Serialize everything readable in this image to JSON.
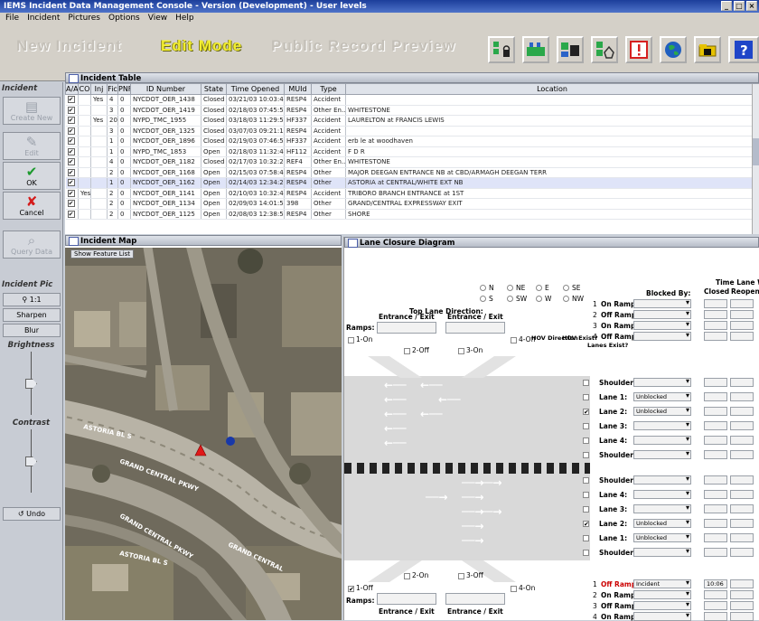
{
  "window": {
    "title": "IEMS Incident Data Management Console - Version (Development) - User levels"
  },
  "menu": [
    "File",
    "Incident",
    "Pictures",
    "Options",
    "View",
    "Help"
  ],
  "modes": {
    "new": "New Incident",
    "edit": "Edit Mode",
    "public": "Public Record Preview"
  },
  "left_panel": {
    "incident_header": "Incident",
    "buttons": [
      {
        "label": "Create New",
        "icon": "📄",
        "enabled": false
      },
      {
        "label": "Edit",
        "icon": "🖉",
        "enabled": false
      },
      {
        "label": "OK",
        "icon": "✔",
        "enabled": true
      },
      {
        "label": "Cancel",
        "icon": "✘",
        "enabled": true
      },
      {
        "label": "Query Data",
        "icon": "🔍",
        "enabled": false
      }
    ],
    "pic_header": "Incident Pic",
    "pic_buttons": [
      "1:1",
      "Sharpen",
      "Blur"
    ],
    "brightness": "Brightness",
    "contrast": "Contrast",
    "undo": "Undo"
  },
  "incident_table": {
    "title": "Incident Table",
    "columns": [
      "A/A",
      "CO",
      "Inj",
      "Fic",
      "PNF",
      "ID Number",
      "State",
      "Time Opened",
      "MUId",
      "Type",
      "Location"
    ],
    "rows": [
      [
        "✔",
        "",
        "Yes",
        "4",
        "0",
        "NYCDOT_OER_1438",
        "Closed",
        "03/21/03 10:03:40",
        "RESP4",
        "Accident",
        ""
      ],
      [
        "✔",
        "",
        "",
        "3",
        "0",
        "NYCDOT_OER_1419",
        "Closed",
        "02/18/03 07:45:50",
        "RESP4",
        "Other En...",
        "WHITESTONE"
      ],
      [
        "✔",
        "",
        "Yes",
        "20",
        "0",
        "NYPD_TMC_1955",
        "Closed",
        "03/18/03 11:29:56",
        "HF337",
        "Accident",
        "LAURELTON at FRANCIS LEWIS"
      ],
      [
        "✔",
        "",
        "",
        "3",
        "0",
        "NYCDOT_OER_1325",
        "Closed",
        "03/07/03 09:21:11",
        "RESP4",
        "Accident",
        ""
      ],
      [
        "✔",
        "",
        "",
        "1",
        "0",
        "NYCDOT_OER_1896",
        "Closed",
        "02/19/03 07:46:53",
        "HF337",
        "Accident",
        "erb le at woodhaven"
      ],
      [
        "✔",
        "",
        "",
        "1",
        "0",
        "NYPD_TMC_1853",
        "Open",
        "02/18/03 11:32:43",
        "HF112",
        "Accident",
        "F D R"
      ],
      [
        "✔",
        "",
        "",
        "4",
        "0",
        "NYCDOT_OER_1182",
        "Closed",
        "02/17/03 10:32:20",
        "REF4",
        "Other En...",
        "WHITESTONE"
      ],
      [
        "✔",
        "",
        "",
        "2",
        "0",
        "NYCDOT_OER_1168",
        "Open",
        "02/15/03 07:58:41",
        "RESP4",
        "Other",
        "MAJOR DEEGAN ENTRANCE NB at CBD/ARMAGH DEEGAN TERR"
      ],
      [
        "✔",
        "",
        "",
        "1",
        "0",
        "NYCDOT_OER_1162",
        "Open",
        "02/14/03 12:34:29",
        "RESP4",
        "Other",
        "ASTORIA at CENTRAL/WHITE EXT NB"
      ],
      [
        "✔",
        "Yes",
        "",
        "2",
        "0",
        "NYCDOT_OER_1141",
        "Open",
        "02/10/03 10:32:48",
        "RESP4",
        "Accident",
        "TRIBORO BRANCH ENTRANCE at 1ST"
      ],
      [
        "✔",
        "",
        "",
        "2",
        "0",
        "NYCDOT_OER_1134",
        "Open",
        "02/09/03 14:01:52",
        "398",
        "Other",
        "GRAND/CENTRAL EXPRESSWAY EXIT"
      ],
      [
        "✔",
        "",
        "",
        "2",
        "0",
        "NYCDOT_OER_1125",
        "Open",
        "02/08/03 12:38:55",
        "RESP4",
        "Other",
        "SHORE"
      ]
    ]
  },
  "map": {
    "title": "Incident Map",
    "feature_btn": "Show Feature List"
  },
  "lane_diagram": {
    "title": "Lane Closure Diagram",
    "top_lane_direction": "Top Lane Direction:",
    "directions": [
      "N",
      "NE",
      "E",
      "SE",
      "S",
      "SW",
      "W",
      "NW"
    ],
    "entrance_exit": "Entrance / Exit",
    "ramps": "Ramps:",
    "ramp_checks_top": [
      "1-On",
      "2-Off",
      "3-On",
      "4-Off"
    ],
    "hov_direction": "HOV Direction",
    "hov_exist": "HOV Exist?",
    "lanes_exist": "Lanes Exist?",
    "blocked_by": "Blocked By:",
    "time_lane_was": "Time Lane Was:",
    "closed": "Closed",
    "reopened": "Reopened",
    "top_rows": [
      {
        "num": "1",
        "label": "On Ramp:"
      },
      {
        "num": "2",
        "label": "Off Ramp:"
      },
      {
        "num": "3",
        "label": "On Ramp:"
      },
      {
        "num": "4",
        "label": "Off Ramp:"
      }
    ],
    "upper_lanes": [
      {
        "label": "Shoulder:",
        "value": ""
      },
      {
        "label": "Lane 1:",
        "value": "Unblocked"
      },
      {
        "label": "Lane 2:",
        "value": "Unblocked"
      },
      {
        "label": "Lane 3:",
        "value": ""
      },
      {
        "label": "Lane 4:",
        "value": ""
      },
      {
        "label": "Shoulder:",
        "value": ""
      }
    ],
    "lower_lanes": [
      {
        "label": "Shoulder:",
        "value": ""
      },
      {
        "label": "Lane 4:",
        "value": ""
      },
      {
        "label": "Lane 3:",
        "value": ""
      },
      {
        "label": "Lane 2:",
        "value": "Unblocked"
      },
      {
        "label": "Lane 1:",
        "value": "Unblocked"
      },
      {
        "label": "Shoulder:",
        "value": ""
      }
    ],
    "ramp_checks_bottom": [
      "1-Off",
      "2-On",
      "3-Off",
      "4-On"
    ],
    "bottom_rows": [
      {
        "num": "1",
        "label": "Off Ramp:",
        "value": "Incident",
        "time": "10:06"
      },
      {
        "num": "2",
        "label": "On Ramp:",
        "value": "",
        "time": ""
      },
      {
        "num": "3",
        "label": "Off Ramp:",
        "value": "",
        "time": ""
      },
      {
        "num": "4",
        "label": "On Ramp:",
        "value": "",
        "time": ""
      }
    ]
  }
}
